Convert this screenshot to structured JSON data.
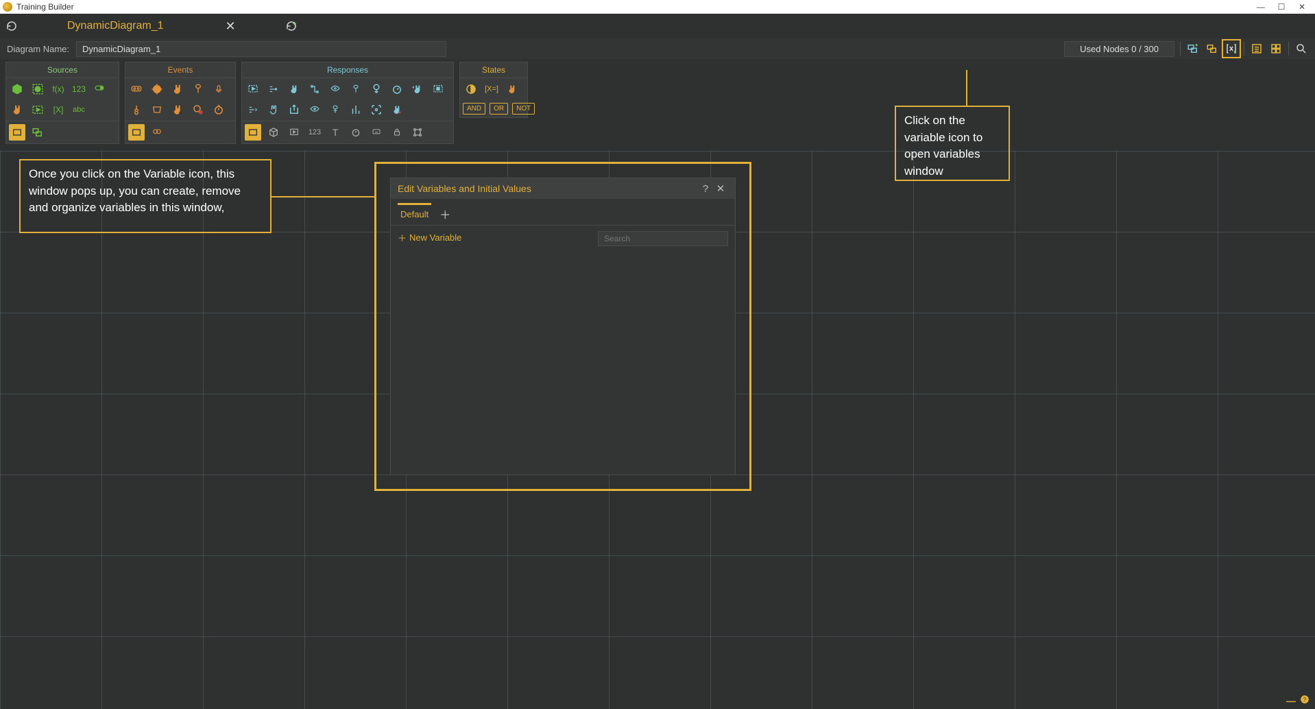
{
  "app": {
    "title": "Training Builder"
  },
  "tab": {
    "title": "DynamicDiagram_1"
  },
  "nameRow": {
    "label": "Diagram Name:",
    "value": "DynamicDiagram_1",
    "usedNodes": "Used Nodes 0 / 300"
  },
  "panels": {
    "sources": "Sources",
    "events": "Events",
    "responses": "Responses",
    "states": "States"
  },
  "logic": {
    "and": "AND",
    "or": "OR",
    "not": "NOT"
  },
  "sourceText": {
    "fx": "f(x)",
    "num": "123",
    "bracket": "[X]",
    "abc": "abc"
  },
  "respText": {
    "num": "123",
    "T": "T"
  },
  "stateText": {
    "setvar": "[X=]"
  },
  "annotations": {
    "left": "Once you click on the Variable icon, this window pops up, you can create, remove and organize variables in this window,",
    "right": "Click on the variable icon to open variables window"
  },
  "modal": {
    "title": "Edit Variables and Initial Values",
    "tab": "Default",
    "newVar": "New Variable",
    "searchPlaceholder": "Search"
  }
}
